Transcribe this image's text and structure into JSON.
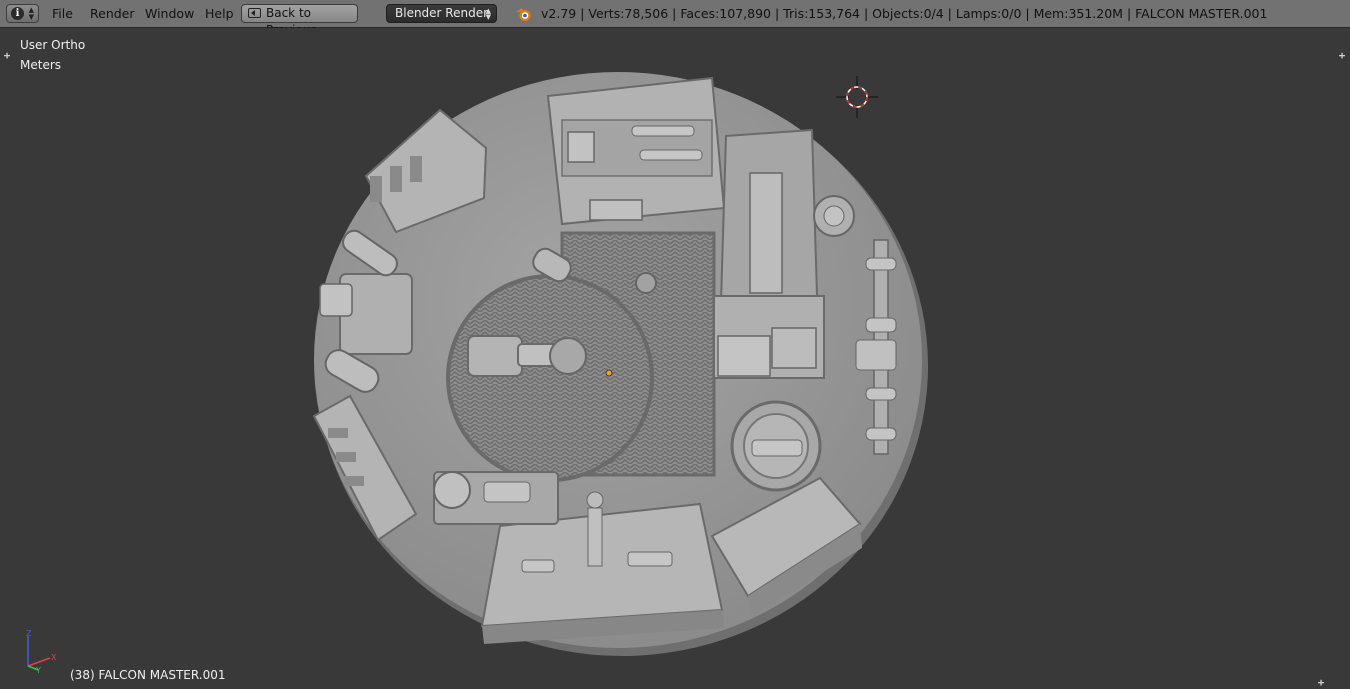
{
  "header": {
    "editor_type_icon": "info-icon",
    "menus": [
      "File",
      "Render",
      "Window",
      "Help"
    ],
    "back_button_label": "Back to Previous",
    "render_engine": "Blender Render",
    "stats": "v2.79 | Verts:78,506 | Faces:107,890 | Tris:153,764 | Objects:0/4 | Lamps:0/0 | Mem:351.20M | FALCON MASTER.001"
  },
  "viewport": {
    "view_mode": "User Ortho",
    "units": "Meters",
    "active_object_label": "(38) FALCON MASTER.001",
    "axis_labels": [
      "Z",
      "Y",
      "X"
    ]
  },
  "colors": {
    "header_bg": "#727272",
    "viewport_bg": "#393939",
    "model_gray": "#9a9a9a",
    "axis_x": "#e04040",
    "axis_y": "#40c040",
    "axis_z": "#4060e0",
    "origin_dot": "#f0a030"
  }
}
